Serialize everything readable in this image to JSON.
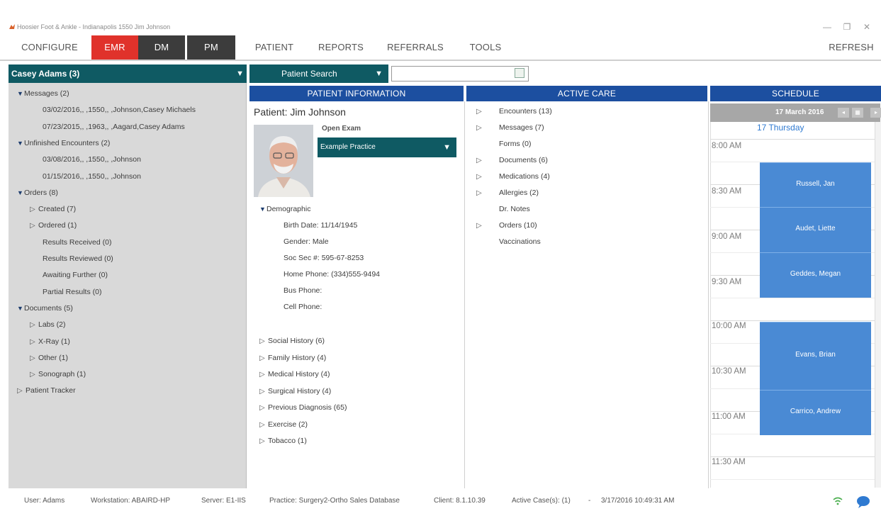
{
  "window": {
    "title": "Hoosier Foot & Ankle - Indianapolis 1550 Jim Johnson",
    "minimize": "—",
    "restore": "❐",
    "close": "✕"
  },
  "menu": {
    "configure": "CONFIGURE",
    "emr": "EMR",
    "dm": "DM",
    "pm": "PM",
    "patient": "PATIENT",
    "reports": "REPORTS",
    "referrals": "REFERRALS",
    "tools": "TOOLS",
    "refresh": "REFRESH"
  },
  "sidebar": {
    "header": "Casey Adams (3)",
    "rows": [
      {
        "label": "Messages (2)",
        "type": "group"
      },
      {
        "label": "03/02/2016,, ,1550,, ,Johnson,Casey Michaels",
        "type": "leaf"
      },
      {
        "label": "07/23/2015,, ,1963,, ,Aagard,Casey Adams",
        "type": "leaf"
      },
      {
        "label": "Unfinished Encounters (2)",
        "type": "group"
      },
      {
        "label": "03/08/2016,, ,1550,, ,Johnson",
        "type": "leaf"
      },
      {
        "label": "01/15/2016,, ,1550,, ,Johnson",
        "type": "leaf"
      },
      {
        "label": "Orders (8)",
        "type": "group"
      },
      {
        "label": "Created (7)",
        "type": "sub"
      },
      {
        "label": "Ordered (1)",
        "type": "sub"
      },
      {
        "label": "Results Received (0)",
        "type": "leaf"
      },
      {
        "label": "Results Reviewed (0)",
        "type": "leaf"
      },
      {
        "label": "Awaiting Further (0)",
        "type": "leaf"
      },
      {
        "label": "Partial Results (0)",
        "type": "leaf"
      },
      {
        "label": "Documents (5)",
        "type": "group"
      },
      {
        "label": "Labs (2)",
        "type": "sub"
      },
      {
        "label": "X-Ray (1)",
        "type": "sub"
      },
      {
        "label": "Other (1)",
        "type": "sub"
      },
      {
        "label": "Sonograph (1)",
        "type": "sub"
      },
      {
        "label": "Patient Tracker",
        "type": "top"
      }
    ]
  },
  "search": {
    "button_label": "Patient Search",
    "value": ""
  },
  "columns": {
    "patient_info": "PATIENT INFORMATION",
    "active_care": "ACTIVE CARE",
    "schedule": "SCHEDULE"
  },
  "patient": {
    "name": "Patient: Jim Johnson",
    "open_exam": "Open Exam",
    "practice": "Example Practice",
    "demographic_label": "Demographic",
    "demographics": [
      "Birth Date: 11/14/1945",
      "Gender: Male",
      "Soc Sec #: 595-67-8253",
      "Home Phone: (334)555-9494",
      "Bus Phone:",
      "Cell Phone:"
    ],
    "histories": [
      "Social History (6)",
      "Family History (4)",
      "Medical History (4)",
      "Surgical History (4)",
      "Previous Diagnosis (65)",
      "Exercise (2)",
      "Tobacco (1)"
    ]
  },
  "active_care": [
    {
      "label": "Encounters (13)",
      "expandable": true
    },
    {
      "label": "Messages (7)",
      "expandable": true
    },
    {
      "label": "Forms (0)",
      "expandable": false
    },
    {
      "label": "Documents (6)",
      "expandable": true
    },
    {
      "label": "Medications (4)",
      "expandable": true
    },
    {
      "label": "Allergies (2)",
      "expandable": true
    },
    {
      "label": "Dr. Notes",
      "expandable": false
    },
    {
      "label": "Orders (10)",
      "expandable": true
    },
    {
      "label": "Vaccinations",
      "expandable": false
    }
  ],
  "schedule": {
    "date": "17 March 2016",
    "day": "17 Thursday",
    "times": [
      "8:00 AM",
      "8:30 AM",
      "9:00 AM",
      "9:30 AM",
      "10:00 AM",
      "10:30 AM",
      "11:00 AM",
      "11:30 AM"
    ],
    "appointments": [
      "Russell, Jan",
      "Audet, Liette",
      "Geddes, Megan",
      "Evans, Brian",
      "Carrico, Andrew"
    ]
  },
  "status": {
    "user": "User: Adams",
    "workstation": "Workstation: ABAIRD-HP",
    "server": "Server: E1-IIS",
    "practice": "Practice: Surgery2-Ortho Sales Database",
    "client": "Client: 8.1.10.39",
    "active_cases": "Active Case(s): (1)",
    "separator": "-",
    "datetime": "3/17/2016 10:49:31 AM"
  },
  "colors": {
    "teal": "#0f5a63",
    "blue_header": "#1c4fa0",
    "emr_red": "#e0322b",
    "appointment": "#4a8ad4"
  }
}
